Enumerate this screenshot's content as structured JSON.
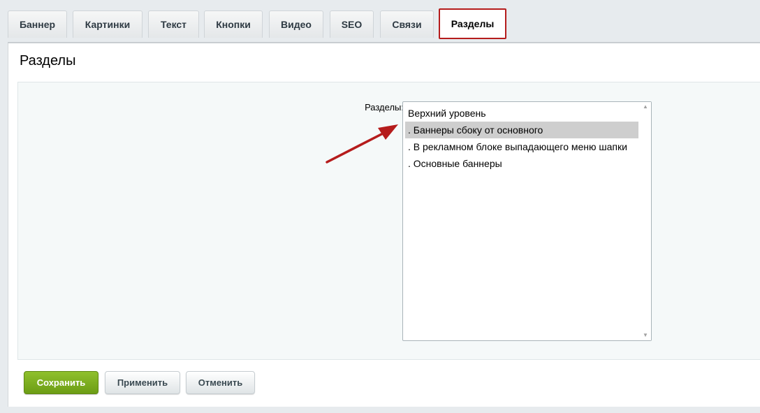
{
  "tabs": [
    {
      "label": "Баннер"
    },
    {
      "label": "Картинки"
    },
    {
      "label": "Текст"
    },
    {
      "label": "Кнопки"
    },
    {
      "label": "Видео"
    },
    {
      "label": "SEO"
    },
    {
      "label": "Связи"
    },
    {
      "label": "Разделы",
      "active": true
    }
  ],
  "panel": {
    "title": "Разделы",
    "field_label": "Разделы:",
    "options": [
      {
        "label": "Верхний уровень",
        "selected": false
      },
      {
        "label": ". Баннеры сбоку от основного",
        "selected": true
      },
      {
        "label": ". В рекламном блоке выпадающего меню шапки",
        "selected": false
      },
      {
        "label": ". Основные баннеры",
        "selected": false
      }
    ]
  },
  "buttons": {
    "save": "Сохранить",
    "apply": "Применить",
    "cancel": "Отменить"
  },
  "colors": {
    "active_tab_border": "#b51c1c",
    "save_button": "#7bab1f",
    "annotation_arrow": "#b51c1c"
  },
  "icons": {
    "scroll_up": "▲",
    "scroll_down": "▼"
  }
}
